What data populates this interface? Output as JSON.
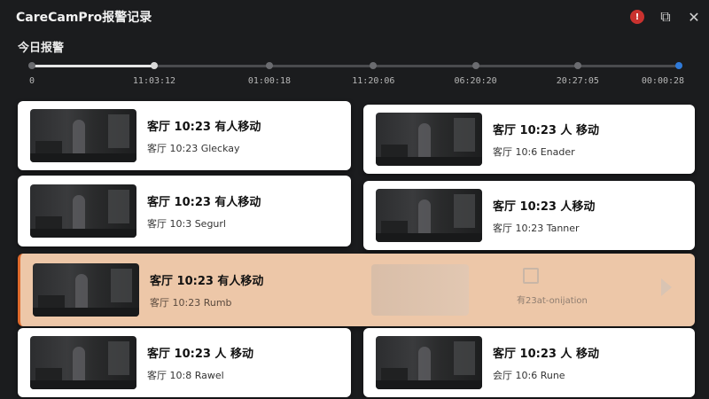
{
  "app": {
    "title": "CareCamPro报警记录"
  },
  "titlebar": {
    "alarm_badge": "!",
    "icons": [
      "alarm-bell-icon",
      "screens-icon",
      "close-icon"
    ],
    "close_glyph": "✕",
    "screens_glyph": "⧉"
  },
  "section": {
    "title": "今日报警"
  },
  "timeline": {
    "labels": [
      "0",
      "11:03:12",
      "01:00:18",
      "11:20:06",
      "06:20:20",
      "20:27:05",
      "00:00:28"
    ],
    "progress": 0.19,
    "colors": {
      "track": "#4a4b4e",
      "fill": "#e6e6e6",
      "end": "#2f7ad9"
    }
  },
  "events": [
    {
      "title": "客厅 10:23 有人移动",
      "subtitle": "客厅 10:23 Gleckay"
    },
    {
      "title": "客厅 10:23 人 移动",
      "subtitle": "客厅 10:6 Enader"
    },
    {
      "title": "客厅 10:23 有人移动",
      "subtitle": "客厅 10:3 Segurl"
    },
    {
      "title": "客厅 10:23 人移动",
      "subtitle": "客厅 10:23 Tanner"
    },
    {
      "title": "客厅 10:23 有人移动",
      "subtitle": "客厅 10:23 Rumb",
      "highlight_text": "有23at-onijation"
    },
    {
      "title": "客厅 10:23 人 移动",
      "subtitle": "客厅 10:8 Rawel"
    },
    {
      "title": "客厅 10:23 人 移动",
      "subtitle": "会厅 10:6 Rune"
    }
  ],
  "colors": {
    "background": "#1b1c1e",
    "card": "#ffffff",
    "highlight": "#ffd6b4",
    "highlight_border": "#e06a2c"
  }
}
